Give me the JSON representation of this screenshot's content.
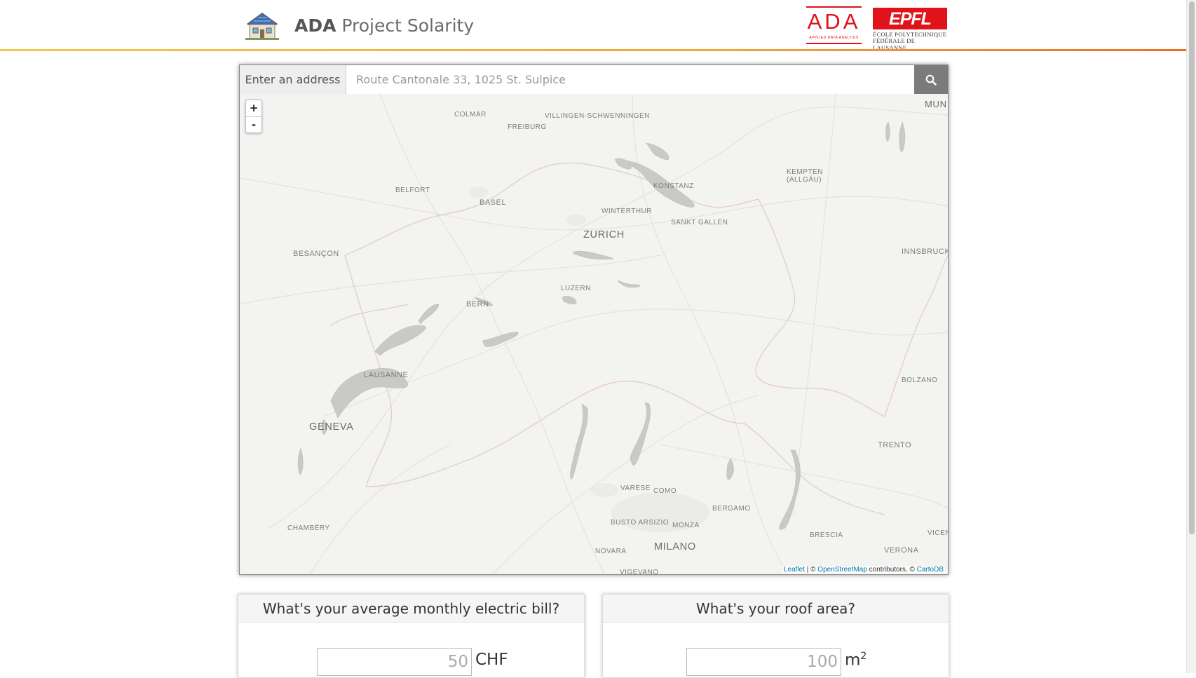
{
  "header": {
    "title_bold": "ADA",
    "title_rest": " Project Solarity",
    "ada_logo_text": "ADA",
    "ada_logo_sub": "APPLIED DATA ANALYSIS",
    "epfl_logo_text": "EPFL",
    "epfl_line1": "ÉCOLE POLYTECHNIQUE",
    "epfl_line2": "FÉDÉRALE DE LAUSANNE",
    "accent_color": "#e0121a"
  },
  "search": {
    "addon_label": "Enter an address",
    "placeholder": "Route Cantonale 33, 1025 St. Sulpice",
    "button_icon": "search-icon"
  },
  "map": {
    "zoom_in": "+",
    "zoom_out": "-",
    "labels": {
      "colmar": "COLMAR",
      "freiburg": "FREIBURG",
      "villingen": "VILLINGEN-SCHWENNINGEN",
      "mun": "MUN",
      "kempten": "KEMPTEN",
      "allgau": "(ALLGÄU)",
      "konstanz": "KONSTANZ",
      "belfort": "BELFORT",
      "basel": "BASEL",
      "winterthur": "WINTERTHUR",
      "sankt_gallen": "SANKT GALLEN",
      "zurich": "ZURICH",
      "besancon": "BESANÇON",
      "innsbruck": "INNSBRUCK",
      "luzern": "LUZERN",
      "bern": "BERN",
      "lausanne": "LAUSANNE",
      "bolzano": "BOLZANO",
      "geneva": "GENEVA",
      "trento": "TRENTO",
      "varese": "VARESE",
      "como": "COMO",
      "bergamo": "BERGAMO",
      "chambery": "CHAMBÉRY",
      "busto": "BUSTO ARSIZIO",
      "monza": "MONZA",
      "vicen": "VICEN",
      "brescia": "BRESCIA",
      "milano": "MILANO",
      "novara": "NOVARA",
      "verona": "VERONA",
      "vigevano": "VIGEVANO"
    },
    "attribution": {
      "leaflet": "Leaflet",
      "sep1": " | © ",
      "osm": "OpenStreetMap",
      "mid": " contributors, © ",
      "cartodb": "CartoDB"
    }
  },
  "bill_panel": {
    "question": "What's your average monthly electric bill?",
    "value": "50",
    "unit": "CHF"
  },
  "roof_panel": {
    "question": "What's your roof area?",
    "value": "100",
    "unit": "m",
    "unit_sup": "2"
  }
}
